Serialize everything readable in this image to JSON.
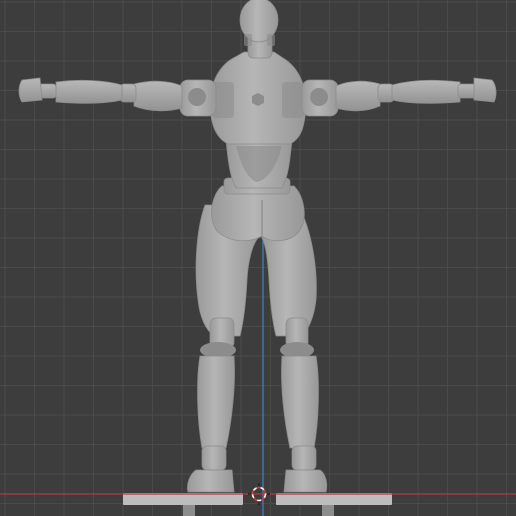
{
  "viewport": {
    "background_color": "#3d3d3d",
    "grid_color": "#4a4a4a",
    "grid_major_color": "#474747"
  },
  "axes": {
    "x_axis_color": "#b23a48",
    "z_axis_color": "#4a7fc4"
  },
  "cursor_3d": {
    "icon": "3d-cursor-icon",
    "color_a": "#ffffff",
    "color_b": "#d03a3a"
  },
  "model": {
    "icon": "articulated-figure-model-icon",
    "view": "back",
    "body_color": "#aaaaaa",
    "shadow_color": "#8c8c8c",
    "highlight_color": "#c4c4c4",
    "stand_color": "#bdbdbd"
  }
}
